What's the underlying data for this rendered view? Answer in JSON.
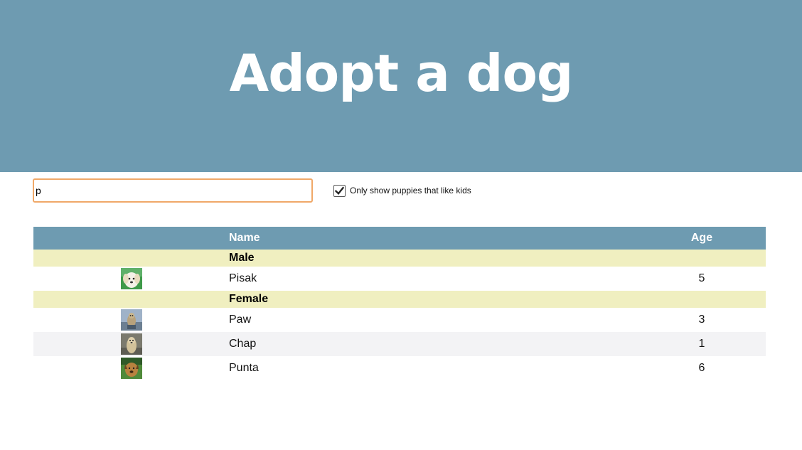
{
  "header": {
    "title": "Adopt a dog"
  },
  "search": {
    "value": "p",
    "placeholder": ""
  },
  "filter": {
    "label": "Only show puppies that like kids",
    "checked": true
  },
  "table": {
    "columns": {
      "image": "",
      "name": "Name",
      "age": "Age"
    },
    "groups": [
      {
        "label": "Male",
        "dogs": [
          {
            "name": "Pisak",
            "age": "5"
          }
        ]
      },
      {
        "label": "Female",
        "dogs": [
          {
            "name": "Paw",
            "age": "3"
          },
          {
            "name": "Chap",
            "age": "1"
          },
          {
            "name": "Punta",
            "age": "6"
          }
        ]
      }
    ]
  },
  "colors": {
    "header_bg": "#6e9bb1",
    "group_row_bg": "#f0efc0",
    "search_border": "#f0a868",
    "alt_row_bg": "#f3f3f5"
  }
}
